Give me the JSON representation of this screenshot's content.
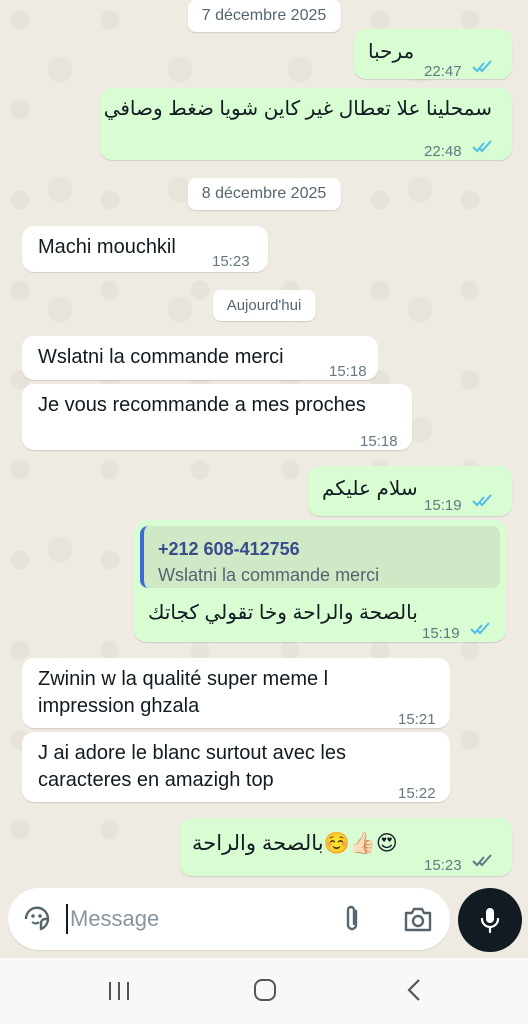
{
  "dates": {
    "first": "7 décembre 2025",
    "second": "8 décembre 2025",
    "today": "Aujourd'hui"
  },
  "messages": [
    {
      "dir": "out",
      "text": "مرحبا",
      "time": "22:47",
      "status": "read"
    },
    {
      "dir": "out",
      "text": "سمحلينا علا تعطال غير كاين شويا ضغط وصافي",
      "time": "22:48",
      "status": "read"
    },
    {
      "dir": "in",
      "text": "Machi mouchkil",
      "time": "15:23"
    },
    {
      "dir": "in",
      "text": "Wslatni la commande merci",
      "time": "15:18"
    },
    {
      "dir": "in",
      "text": "Je vous recommande a mes proches",
      "time": "15:18"
    },
    {
      "dir": "out",
      "text": "سلام عليكم",
      "time": "15:19",
      "status": "read"
    },
    {
      "dir": "out",
      "reply_to": {
        "name": "+212 608-412756",
        "text": "Wslatni la commande merci"
      },
      "text": "بالصحة والراحة وخا تقولي كجاتك",
      "time": "15:19",
      "status": "read"
    },
    {
      "dir": "in",
      "lines": [
        "Zwinin w la qualité super meme l",
        "impression ghzala"
      ],
      "time": "15:21"
    },
    {
      "dir": "in",
      "lines": [
        "J ai adore le blanc surtout avec les",
        "caracteres en amazigh top"
      ],
      "time": "15:22"
    },
    {
      "dir": "out",
      "text": "😍👍🏻☺️بالصحة والراحة",
      "time": "15:23",
      "status": "delivered"
    }
  ],
  "composer": {
    "placeholder": "Message"
  },
  "icons": [
    "sticker-icon",
    "attach-icon",
    "camera-icon",
    "mic-icon",
    "recents-icon",
    "home-icon",
    "back-icon"
  ],
  "colors": {
    "outgoing": "#d9fdd3",
    "incoming": "#ffffff",
    "read_ticks": "#53bdeb",
    "delivered_ticks": "#667781"
  }
}
